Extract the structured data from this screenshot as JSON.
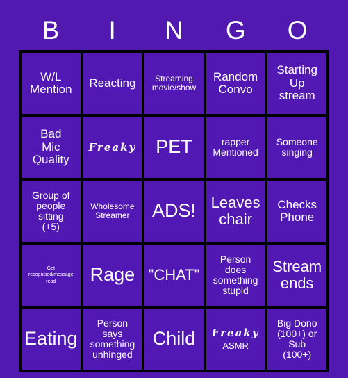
{
  "card": {
    "title_letters": [
      "B",
      "I",
      "N",
      "G",
      "O"
    ],
    "background_color": "#5219B0",
    "cell_color": "#5218B4",
    "border_color": "#000000",
    "text_color": "#FFFFFF",
    "rows": 5,
    "columns": 5
  },
  "cells": [
    {
      "text": "W/L\nMention",
      "size": "sz-md",
      "style": "plain"
    },
    {
      "text": "Reacting",
      "size": "sz-md",
      "style": "plain"
    },
    {
      "text": "Streaming\nmovie/show",
      "size": "sz-xs",
      "style": "plain"
    },
    {
      "text": "Random\nConvo",
      "size": "sz-md",
      "style": "plain"
    },
    {
      "text": "Starting\nUp\nstream",
      "size": "sz-md",
      "style": "plain"
    },
    {
      "text": "Bad\nMic\nQuality",
      "size": "sz-md",
      "style": "plain"
    },
    {
      "text": "Freaky",
      "size": "sz-md",
      "style": "script"
    },
    {
      "text": "PET",
      "size": "sz-xl",
      "style": "plain"
    },
    {
      "text": "rapper\nMentioned",
      "size": "sz-sm",
      "style": "plain"
    },
    {
      "text": "Someone\nsinging",
      "size": "sz-sm",
      "style": "plain"
    },
    {
      "text": "Group of\npeople\nsitting\n(+5)",
      "size": "sz-sm",
      "style": "plain"
    },
    {
      "text": "Wholesome\nStreamer",
      "size": "sz-xs",
      "style": "plain"
    },
    {
      "text": "ADS!",
      "size": "sz-xl",
      "style": "plain"
    },
    {
      "text": "Leaves\nchair",
      "size": "sz-lg",
      "style": "plain"
    },
    {
      "text": "Checks\nPhone",
      "size": "sz-md",
      "style": "plain"
    },
    {
      "text": "Get\nrecognised/message\nread",
      "size": "sz-xxs",
      "style": "plain"
    },
    {
      "text": "Rage",
      "size": "sz-xl",
      "style": "plain"
    },
    {
      "text": "\"CHAT\"",
      "size": "sz-lg",
      "style": "plain"
    },
    {
      "text": "Person\ndoes\nsomething\nstupid",
      "size": "sz-sm",
      "style": "plain"
    },
    {
      "text": "Stream\nends",
      "size": "sz-lg",
      "style": "plain"
    },
    {
      "text": "Eating",
      "size": "sz-xl",
      "style": "plain"
    },
    {
      "text": "Person\nsays\nsomething\nunhinged",
      "size": "sz-sm",
      "style": "plain"
    },
    {
      "text": "Child",
      "size": "sz-xl",
      "style": "plain"
    },
    {
      "text": "Freaky",
      "size": "sz-md",
      "style": "script",
      "sub_label": "ASMR"
    },
    {
      "text": "Big Dono\n(100+) or\nSub\n(100+)",
      "size": "sz-sm",
      "style": "plain"
    }
  ]
}
